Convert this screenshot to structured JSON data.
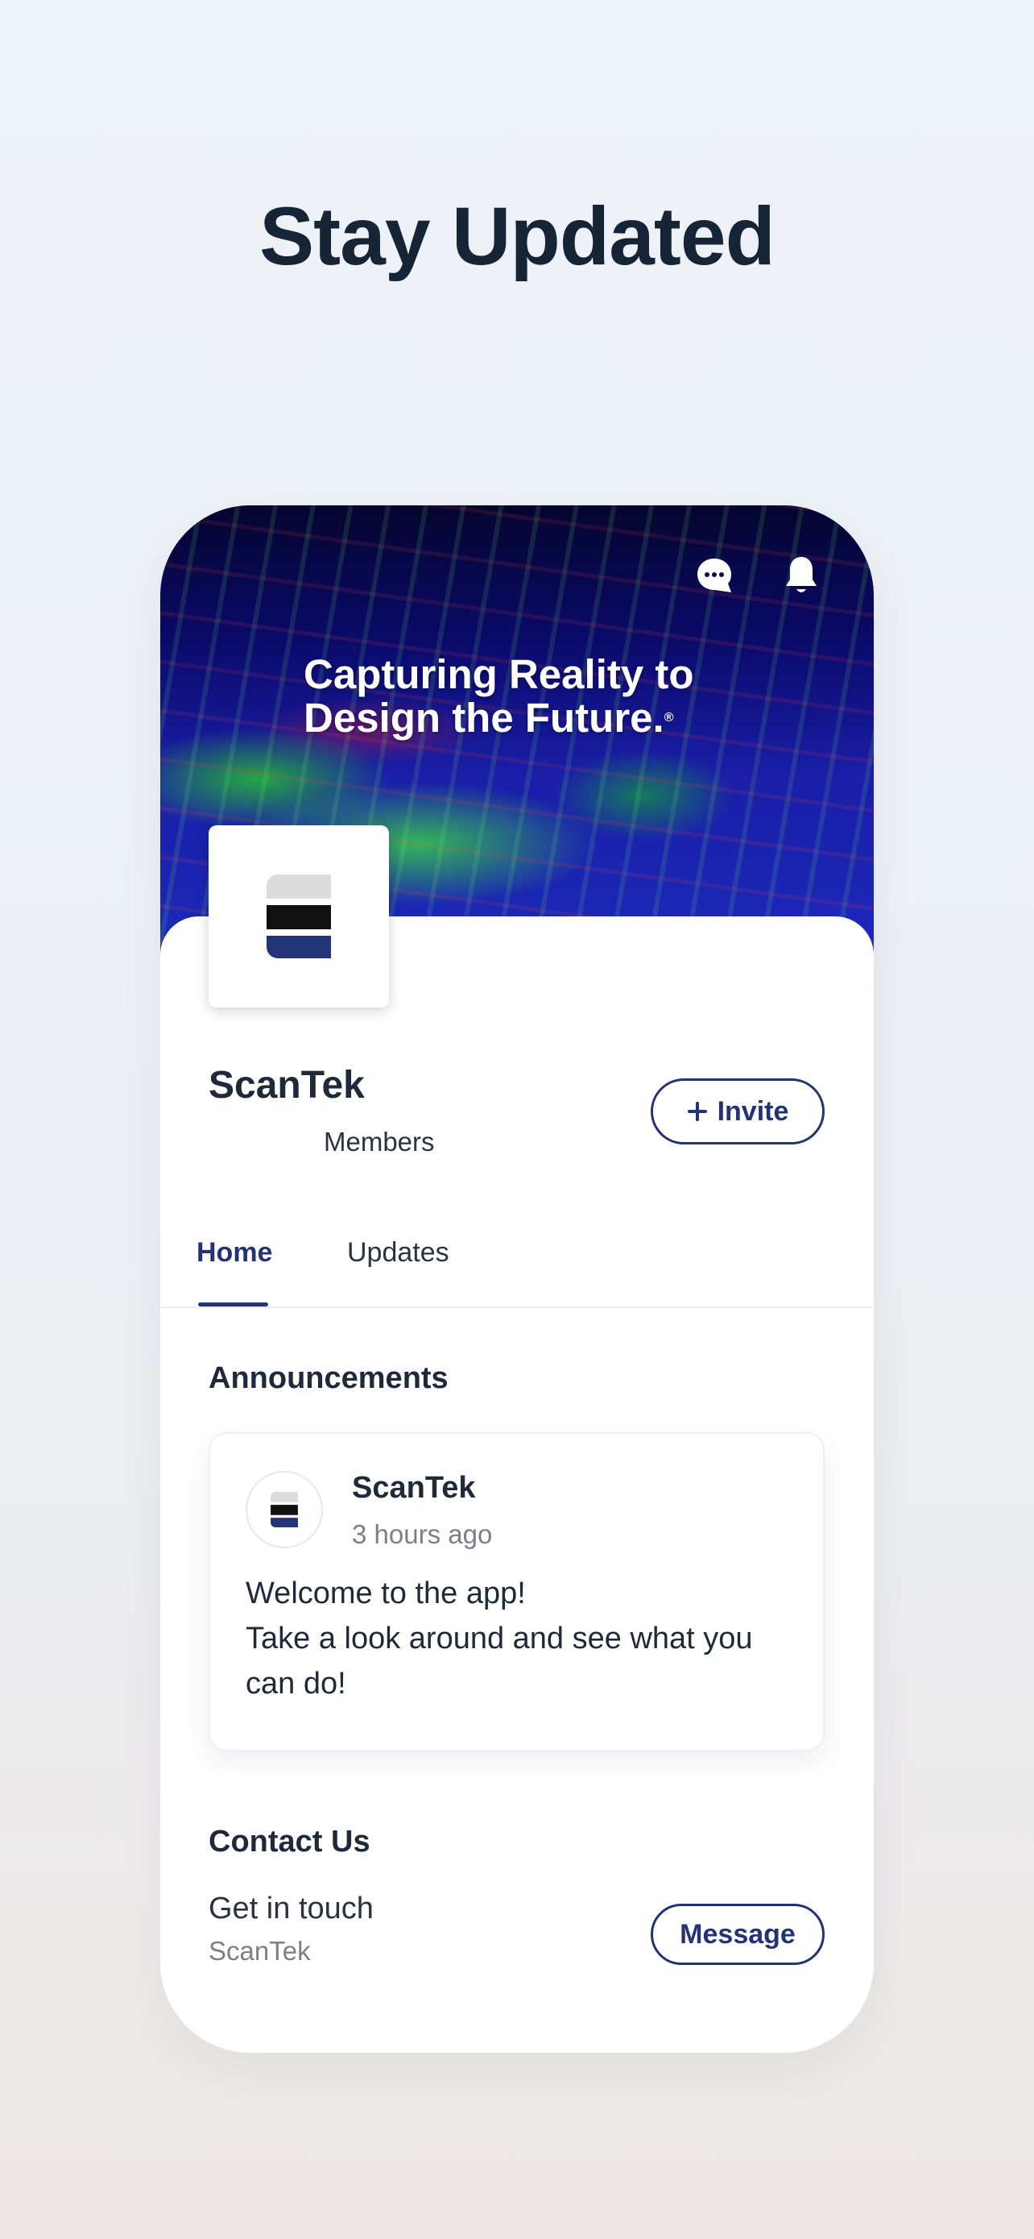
{
  "headline": "Stay Updated",
  "cover": {
    "tagline_line1": "Capturing Reality to",
    "tagline_line2": "Design the Future.",
    "registered_mark": "®",
    "icons": [
      "chat-icon",
      "bell-icon"
    ]
  },
  "profile": {
    "name": "ScanTek",
    "members_label": "Members",
    "invite_label": "Invite",
    "invite_icon": "plus-icon"
  },
  "tabs": [
    {
      "label": "Home",
      "active": true
    },
    {
      "label": "Updates",
      "active": false
    }
  ],
  "announcements": {
    "title": "Announcements",
    "post": {
      "author": "ScanTek",
      "time": "3 hours ago",
      "line1": "Welcome to the app!",
      "line2": "Take a look around and see what you can do!"
    }
  },
  "contact": {
    "title": "Contact Us",
    "line": "Get in touch",
    "org": "ScanTek",
    "message_label": "Message"
  },
  "colors": {
    "accent": "#243276",
    "text_dark": "#1e2a3a",
    "muted": "#7a808a"
  }
}
